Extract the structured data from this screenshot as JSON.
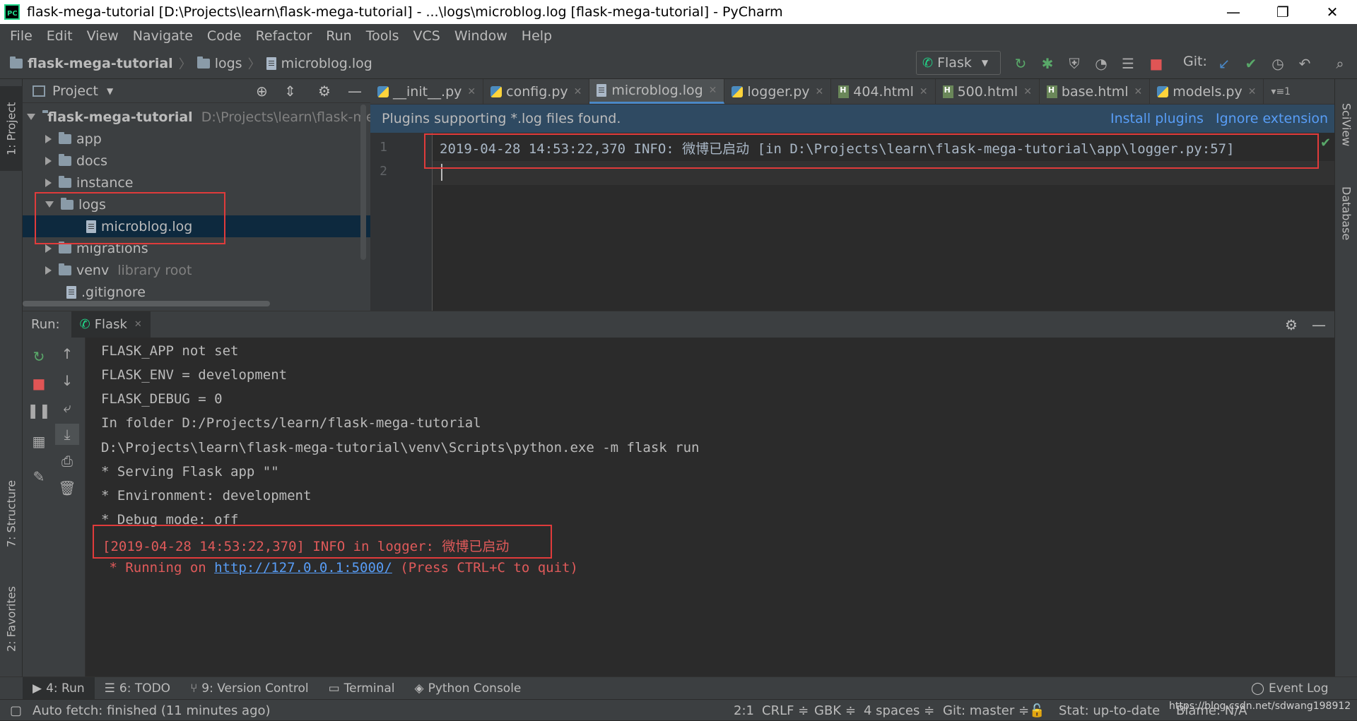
{
  "window": {
    "title": "flask-mega-tutorial [D:\\Projects\\learn\\flask-mega-tutorial] - ...\\logs\\microblog.log [flask-mega-tutorial] - PyCharm",
    "logo": "PC",
    "minimize": "—",
    "restore": "❐",
    "close": "✕"
  },
  "menu": [
    "File",
    "Edit",
    "View",
    "Navigate",
    "Code",
    "Refactor",
    "Run",
    "Tools",
    "VCS",
    "Window",
    "Help"
  ],
  "breadcrumb": [
    "flask-mega-tutorial",
    "logs",
    "microblog.log"
  ],
  "toolbar": {
    "run_config": "Flask",
    "git_label": "Git:"
  },
  "left_strip": {
    "project": "1: Project",
    "structure": "7: Structure",
    "favorites": "2: Favorites"
  },
  "right_strip": {
    "sciview": "SciView",
    "database": "Database"
  },
  "project_panel": {
    "title": "Project",
    "root": {
      "name": "flask-mega-tutorial",
      "path": "D:\\Projects\\learn\\flask-mega"
    },
    "items": [
      {
        "name": "app",
        "type": "folder"
      },
      {
        "name": "docs",
        "type": "folder"
      },
      {
        "name": "instance",
        "type": "folder"
      },
      {
        "name": "logs",
        "type": "folder-open"
      },
      {
        "name": "microblog.log",
        "type": "file"
      },
      {
        "name": "migrations",
        "type": "folder"
      },
      {
        "name": "venv",
        "type": "folder",
        "note": "library root"
      },
      {
        "name": ".gitignore",
        "type": "file"
      }
    ]
  },
  "editor_tabs": [
    {
      "label": "__init__.py",
      "icon": "python-icon"
    },
    {
      "label": "config.py",
      "icon": "python-icon"
    },
    {
      "label": "microblog.log",
      "icon": "file-icon",
      "active": true
    },
    {
      "label": "logger.py",
      "icon": "python-icon"
    },
    {
      "label": "404.html",
      "icon": "html-icon"
    },
    {
      "label": "500.html",
      "icon": "html-icon"
    },
    {
      "label": "base.html",
      "icon": "html-icon"
    },
    {
      "label": "models.py",
      "icon": "python-icon"
    }
  ],
  "tab_overflow": "▾≡1",
  "notification": {
    "message": "Plugins supporting *.log files found.",
    "install": "Install plugins",
    "ignore": "Ignore extension"
  },
  "editor": {
    "lines": [
      {
        "num": "1",
        "text": "2019-04-28 14:53:22,370 INFO: 微博已启动 [in D:\\Projects\\learn\\flask-mega-tutorial\\app\\logger.py:57]"
      },
      {
        "num": "2",
        "text": ""
      }
    ]
  },
  "run_panel": {
    "label": "Run:",
    "tab": "Flask",
    "console": [
      {
        "text": "FLASK_APP not set",
        "style": "normal"
      },
      {
        "text": "FLASK_ENV = development",
        "style": "normal"
      },
      {
        "text": "FLASK_DEBUG = 0",
        "style": "normal"
      },
      {
        "text": "In folder D:/Projects/learn/flask-mega-tutorial",
        "style": "normal"
      },
      {
        "text": "D:\\Projects\\learn\\flask-mega-tutorial\\venv\\Scripts\\python.exe -m flask run",
        "style": "normal"
      },
      {
        "text": " * Serving Flask app \"\"",
        "style": "normal"
      },
      {
        "text": " * Environment: development",
        "style": "normal"
      },
      {
        "text": " * Debug mode: off",
        "style": "normal"
      },
      {
        "text": "[2019-04-28 14:53:22,370] INFO in logger: 微博已启动",
        "style": "red"
      }
    ],
    "running_prefix": " * Running on ",
    "running_link": "http://127.0.0.1:5000/",
    "running_suffix": " (Press CTRL+C to quit)"
  },
  "bottom_tabs": [
    {
      "label": "4: Run",
      "active": true
    },
    {
      "label": "6: TODO"
    },
    {
      "label": "9: Version Control"
    },
    {
      "label": "Terminal"
    },
    {
      "label": "Python Console"
    }
  ],
  "event_log": "Event Log",
  "status": {
    "message": "Auto fetch: finished (11 minutes ago)",
    "position": "2:1",
    "line_sep": "CRLF ≑",
    "encoding": "GBK ≑",
    "indent": "4 spaces ≑",
    "git": "Git: master ≑",
    "stat": "Stat: up-to-date",
    "blame": "Blame: N/A",
    "watermark": "https://blog.csdn.net/sdwang198912"
  },
  "colors": {
    "accent": "#4a88c7",
    "highlight": "#e03b3b",
    "link": "#589df6"
  }
}
